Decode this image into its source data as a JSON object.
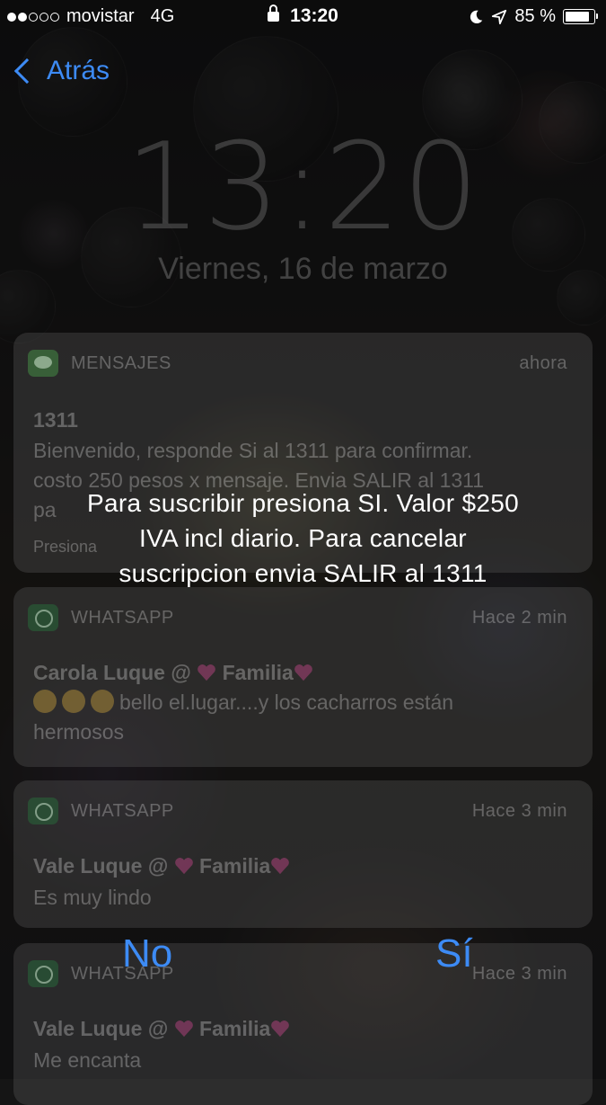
{
  "status_bar": {
    "carrier": "movistar",
    "network": "4G",
    "time": "13:20",
    "battery": "85 %",
    "battery_level": 0.85,
    "signal_bars_filled": 2,
    "signal_bars_total": 5
  },
  "nav": {
    "back_label": "Atrás"
  },
  "lockscreen": {
    "time": "13:20",
    "date": "Viernes, 16 de marzo"
  },
  "notifications": [
    {
      "app": "MENSAJES",
      "icon": "messages-icon",
      "time": "ahora",
      "title": "1311",
      "body_lines": [
        "Bienvenido, responde Si al 1311 para confirmar.",
        "costo 250 pesos x mensaje. Envia SALIR al 1311",
        "pa"
      ],
      "hint": "Presiona"
    },
    {
      "app": "WHATSAPP",
      "icon": "whatsapp-icon",
      "time": "Hace 2 min",
      "title_name": "Carola Luque @",
      "title_group": "Familia",
      "body_first": "bello el.lugar....y los cacharros están",
      "body_second": "hermosos"
    },
    {
      "app": "WHATSAPP",
      "icon": "whatsapp-icon",
      "time": "Hace 3 min",
      "title_name": "Vale Luque @",
      "title_group": "Familia",
      "body": "Es muy lindo"
    },
    {
      "app": "WHATSAPP",
      "icon": "whatsapp-icon",
      "time": "Hace 3 min",
      "title_name": "Vale Luque @",
      "title_group": "Familia",
      "body": "Me encanta"
    }
  ],
  "prompt": {
    "lines": [
      "Para suscribir presiona SI. Valor $250",
      "IVA incl diario. Para cancelar",
      "suscripcion envia SALIR al 1311"
    ],
    "no_label": "No",
    "yes_label": "Sí"
  },
  "colors": {
    "accent": "#3d8bf5",
    "text": "#ffffff"
  }
}
